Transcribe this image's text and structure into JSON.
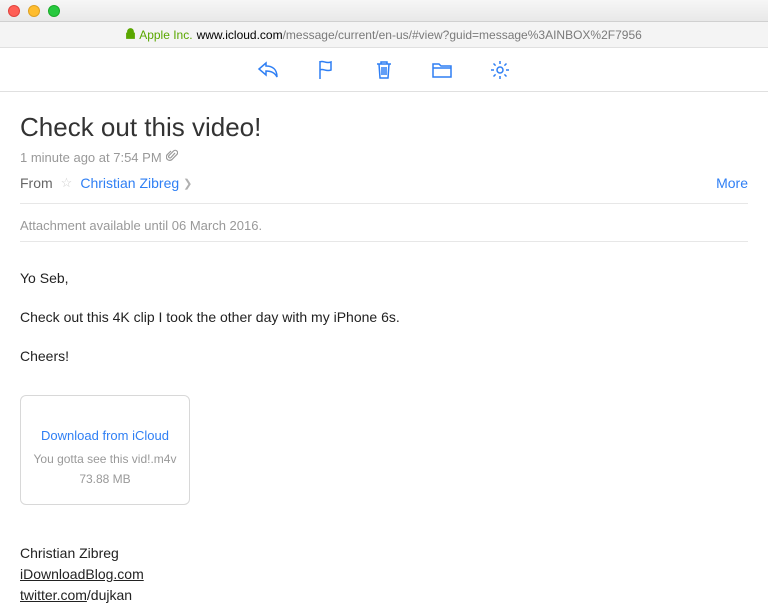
{
  "url": {
    "company": "Apple Inc.",
    "domain": "www.icloud.com",
    "path": "/message/current/en-us/#view?guid=message%3AINBOX%2F7956"
  },
  "email": {
    "subject": "Check out this video!",
    "timestamp": "1 minute ago at 7:54 PM",
    "from_label": "From",
    "sender": "Christian Zibreg",
    "more_label": "More",
    "expiry": "Attachment available until 06 March 2016.",
    "body": {
      "greeting": "Yo Seb,",
      "line1": "Check out this 4K clip I took the other day with my iPhone 6s.",
      "signoff": "Cheers!"
    },
    "attachment": {
      "download_label": "Download from iCloud",
      "filename": "You gotta see this vid!.m4v",
      "filesize": "73.88 MB"
    },
    "signature": {
      "name": "Christian Zibreg",
      "link1": "iDownloadBlog.com",
      "link2_domain": "twitter.com",
      "link2_handle": "/dujkan"
    }
  }
}
